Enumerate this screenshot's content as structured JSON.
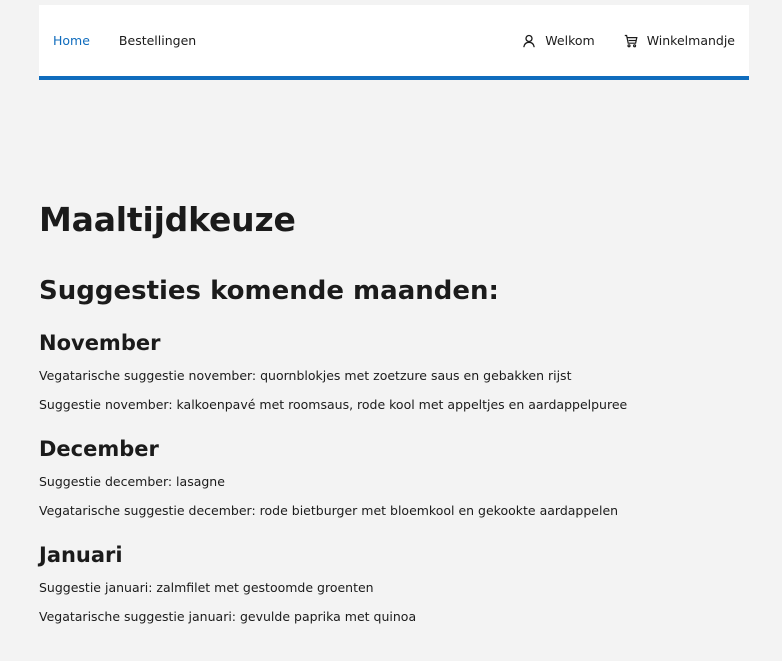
{
  "nav": {
    "home_label": "Home",
    "orders_label": "Bestellingen",
    "welcome_label": "Welkom",
    "cart_label": "Winkelmandje",
    "user_icon": "user-icon",
    "cart_icon": "cart-icon",
    "accent_color": "#0f6cbd"
  },
  "page": {
    "title": "Maaltijdkeuze",
    "section_title": "Suggesties komende maanden:",
    "months": [
      {
        "name": "November",
        "suggestions": [
          "Vegatarische suggestie november: quornblokjes met zoetzure saus en gebakken rijst",
          "Suggestie november: kalkoenpavé met roomsaus, rode kool met appeltjes en aardappelpuree"
        ]
      },
      {
        "name": "December",
        "suggestions": [
          "Suggestie december: lasagne",
          "Vegatarische suggestie december: rode bietburger met bloemkool en gekookte aardappelen"
        ]
      },
      {
        "name": "Januari",
        "suggestions": [
          "Suggestie januari: zalmfilet met gestoomde groenten",
          "Vegatarische suggestie januari: gevulde paprika met quinoa"
        ]
      }
    ]
  }
}
